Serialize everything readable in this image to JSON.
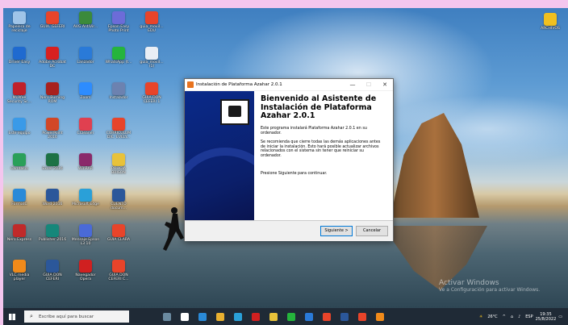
{
  "desktop_icons": [
    {
      "label": "Papelera de reciclaje",
      "color": "#9fc4e8",
      "col": 0,
      "row": 0
    },
    {
      "label": "GUIA. GEFERI",
      "color": "#e8442a",
      "col": 1,
      "row": 0
    },
    {
      "label": "AVG AntiVir...",
      "color": "#3b8a3b",
      "col": 2,
      "row": 0
    },
    {
      "label": "Epson Easy Photo Print",
      "color": "#6c6cd8",
      "col": 3,
      "row": 0
    },
    {
      "label": "guia_movil... EDU",
      "color": "#e8442a",
      "col": 4,
      "row": 0
    },
    {
      "label": "Driver Easy",
      "color": "#1f6ad0",
      "col": 0,
      "row": 1
    },
    {
      "label": "Adobe Acrobat DC",
      "color": "#d82020",
      "col": 1,
      "row": 1
    },
    {
      "label": "Lanzador",
      "color": "#2a7ad8",
      "col": 2,
      "row": 1
    },
    {
      "label": "WhatsApp (t...",
      "color": "#25b43c",
      "col": 3,
      "row": 1
    },
    {
      "label": "guia_movil... (1)",
      "color": "#e9eef5",
      "col": 4,
      "row": 1
    },
    {
      "label": "McAfee Security Sc...",
      "color": "#c0202a",
      "col": 0,
      "row": 2
    },
    {
      "label": "Nero Burning ROM",
      "color": "#a8201e",
      "col": 1,
      "row": 2
    },
    {
      "label": "Zoom",
      "color": "#2d8cff",
      "col": 2,
      "row": 2
    },
    {
      "label": "Instalador",
      "color": "#6c82b0",
      "col": 3,
      "row": 2
    },
    {
      "label": "GUIA DON CEFERI 1",
      "color": "#e8442a",
      "col": 4,
      "row": 2
    },
    {
      "label": "Este equipo",
      "color": "#3a9ae8",
      "col": 0,
      "row": 3
    },
    {
      "label": "PowerPoint 2016",
      "color": "#d24726",
      "col": 1,
      "row": 3
    },
    {
      "label": "CCleaner",
      "color": "#e04050",
      "col": 2,
      "row": 3
    },
    {
      "label": "CURRICULUM DIC. EVELY...",
      "color": "#e8442a",
      "col": 3,
      "row": 3
    },
    {
      "label": "Camtasia",
      "color": "#2aa05a",
      "col": 0,
      "row": 4
    },
    {
      "label": "Excel 2016",
      "color": "#1d7245",
      "col": 1,
      "row": 4
    },
    {
      "label": "WinRAR",
      "color": "#8a2a6a",
      "col": 2,
      "row": 4
    },
    {
      "label": "POLICIA BRISON",
      "color": "#e8c23a",
      "col": 3,
      "row": 4
    },
    {
      "label": "FormatC",
      "color": "#2a8ad8",
      "col": 0,
      "row": 5
    },
    {
      "label": "Word 2016",
      "color": "#2b579a",
      "col": 1,
      "row": 5
    },
    {
      "label": "Microsoft Edge",
      "color": "#2aa0d8",
      "col": 2,
      "row": 5
    },
    {
      "label": "CUENTO docum...",
      "color": "#2b579a",
      "col": 3,
      "row": 5
    },
    {
      "label": "Nero Express",
      "color": "#c02a2a",
      "col": 0,
      "row": 6
    },
    {
      "label": "Publisher 2016",
      "color": "#16877a",
      "col": 1,
      "row": 6
    },
    {
      "label": "Mensaje Epson L3 10",
      "color": "#4a6ad8",
      "col": 2,
      "row": 6
    },
    {
      "label": "GUIA CLARA",
      "color": "#e8442a",
      "col": 3,
      "row": 6
    },
    {
      "label": "VLC media player",
      "color": "#f08a1a",
      "col": 0,
      "row": 7
    },
    {
      "label": "GUIA DON CEFERI",
      "color": "#2b579a",
      "col": 1,
      "row": 7
    },
    {
      "label": "Navegador Opera",
      "color": "#d02020",
      "col": 2,
      "row": 7
    },
    {
      "label": "GUIA DON CEFERI C...",
      "color": "#e8442a",
      "col": 3,
      "row": 7
    }
  ],
  "archivos_icon": {
    "label": "ARCHIVOS",
    "color": "#f0c020"
  },
  "dialog": {
    "title": "Instalación de Plataforma Azahar 2.0.1",
    "minimize": "—",
    "maximize": "☐",
    "close": "✕",
    "heading": "Bienvenido al Asistente de Instalación de Plataforma Azahar 2.0.1",
    "para1": "Este programa instalará Plataforma Azahar 2.0.1 en su ordenador.",
    "para2": "Se recomienda que cierre todas las demás aplicaciones antes de iniciar la instalación. Esto hará posible actualizar archivos relacionados con el sistema sin tener que reiniciar su ordenador.",
    "para3": "Presione Siguiente para continuar.",
    "next_label": "Siguiente >",
    "cancel_label": "Cancelar"
  },
  "watermark": {
    "line1": "Activar Windows",
    "line2": "Ve a Configuración para activar Windows."
  },
  "taskbar": {
    "search_placeholder": "Escribe aquí para buscar",
    "apps": [
      "#6a8aa0",
      "#ffffff",
      "#2a8ad8",
      "#e8b030",
      "#2aa0d8",
      "#d02020",
      "#e8c23a",
      "#25b43c",
      "#2a7ad8",
      "#e8442a",
      "#2b579a",
      "#e8442a",
      "#f08a1a"
    ],
    "temperature": "26°C",
    "lang": "ESP",
    "time": "19:35",
    "date": "25/8/2022"
  }
}
